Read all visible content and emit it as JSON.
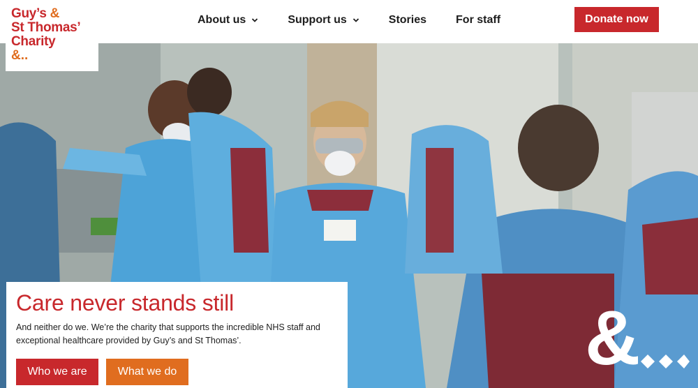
{
  "logo": {
    "line1": "Guy’s",
    "line1_amp": "&",
    "line2": "St Thomas’",
    "line3": "Charity",
    "line4": "&.."
  },
  "nav": {
    "items": [
      {
        "label": "About us",
        "has_dropdown": true
      },
      {
        "label": "Support us",
        "has_dropdown": true
      },
      {
        "label": "Stories",
        "has_dropdown": false
      },
      {
        "label": "For staff",
        "has_dropdown": false
      }
    ],
    "donate_label": "Donate now"
  },
  "hero": {
    "title": "Care never stands still",
    "text": "And neither do we. We’re the charity that supports the incredible NHS staff and exceptional healthcare provided by Guy’s and St Thomas’.",
    "primary_button": "Who we are",
    "secondary_button": "What we do"
  },
  "colors": {
    "brand_red": "#c8282c",
    "brand_orange": "#e06d1f",
    "text": "#1d1d1d"
  },
  "icons": [
    "chevron-down-icon",
    "ampersand-logo-mark"
  ]
}
